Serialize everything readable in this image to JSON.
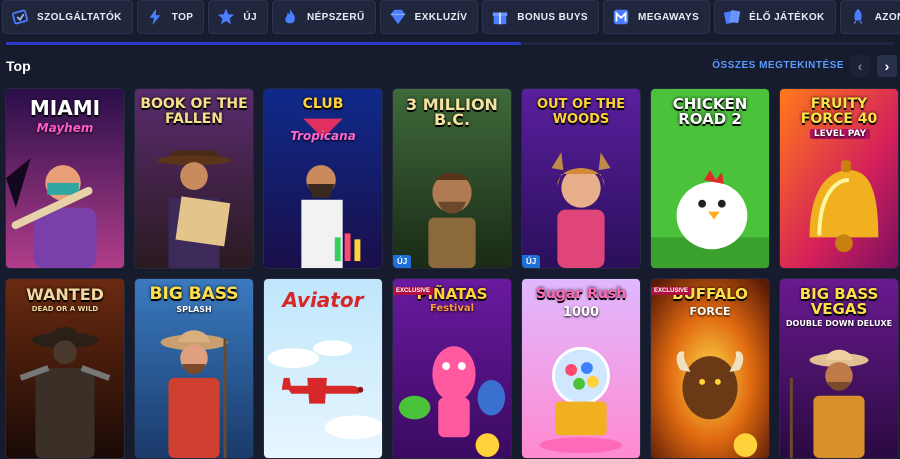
{
  "categories": [
    {
      "label": "SZOLGÁLTATÓK",
      "icon": "providers-icon",
      "color": "#4a7dff"
    },
    {
      "label": "TOP",
      "icon": "lightning-icon",
      "color": "#4a7dff"
    },
    {
      "label": "ÚJ",
      "icon": "star-icon",
      "color": "#4a7dff"
    },
    {
      "label": "NÉPSZERŰ",
      "icon": "flame-icon",
      "color": "#4a7dff"
    },
    {
      "label": "EXKLUZÍV",
      "icon": "diamond-icon",
      "color": "#4a7dff"
    },
    {
      "label": "BONUS BUYS",
      "icon": "gift-icon",
      "color": "#4a7dff"
    },
    {
      "label": "MEGAWAYS",
      "icon": "megaways-icon",
      "color": "#4a7dff"
    },
    {
      "label": "ÉLŐ JÁTÉKOK",
      "icon": "live-cards-icon",
      "color": "#4a7dff"
    },
    {
      "label": "AZON",
      "icon": "rocket-icon",
      "color": "#4a7dff"
    }
  ],
  "scroll_progress": 0.58,
  "section": {
    "title": "Top",
    "see_all": "ÖSSZES MEGTEKINTÉSE",
    "prev": "‹",
    "next": "›"
  },
  "games": [
    {
      "title": "MIAMI",
      "subtitle": "Mayhem",
      "badge": ""
    },
    {
      "title": "BOOK OF THE FALLEN",
      "subtitle": "",
      "badge": ""
    },
    {
      "title": "CLUB",
      "subtitle": "Tropicana",
      "badge": ""
    },
    {
      "title": "3 MILLION B.C.",
      "subtitle": "",
      "badge": "ÚJ"
    },
    {
      "title": "OUT OF THE WOODS",
      "subtitle": "",
      "badge": "ÚJ"
    },
    {
      "title": "CHICKEN ROAD 2",
      "subtitle": "",
      "badge": ""
    },
    {
      "title": "FRUITY FORCE 40",
      "subtitle": "LEVEL PAY",
      "badge": ""
    },
    {
      "title": "WANTED",
      "subtitle": "DEAD OR A WILD",
      "badge": ""
    },
    {
      "title": "BIG BASS",
      "subtitle": "SPLASH",
      "badge": ""
    },
    {
      "title": "Aviator",
      "subtitle": "",
      "badge": ""
    },
    {
      "title": "PIÑATAS",
      "subtitle": "Festival",
      "badge": "EXCLUSIVE"
    },
    {
      "title": "Sugar Rush",
      "subtitle": "1000",
      "badge": ""
    },
    {
      "title": "BUFFALO",
      "subtitle": "FORCE",
      "badge": "EXCLUSIVE"
    },
    {
      "title": "BIG BASS VEGAS",
      "subtitle": "DOUBLE DOWN DELUXE",
      "badge": ""
    }
  ]
}
